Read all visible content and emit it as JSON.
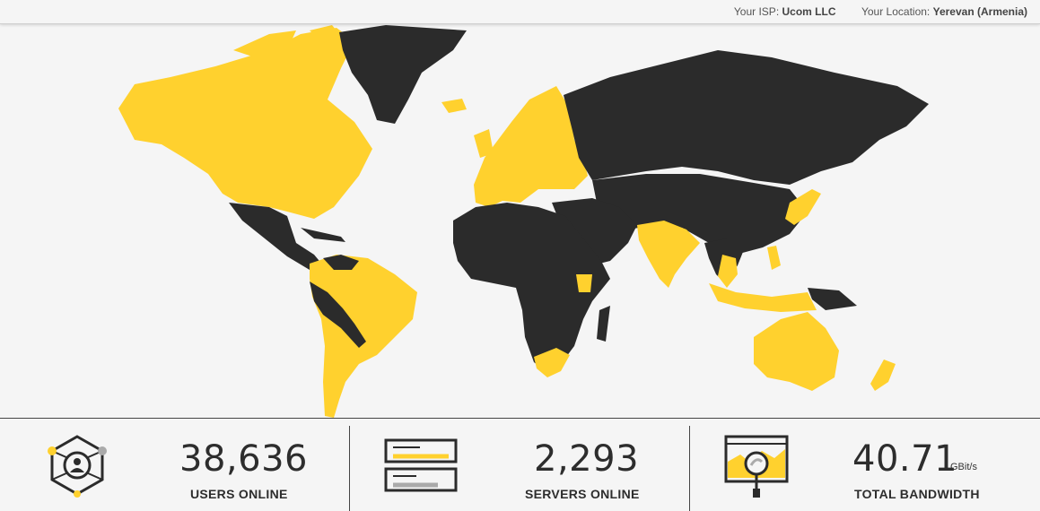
{
  "header": {
    "isp_label": "Your ISP:",
    "isp_value": "Ucom LLC",
    "location_label": "Your Location:",
    "location_value": "Yerevan (Armenia)"
  },
  "map": {
    "icon": "world-map",
    "colors": {
      "covered": "#ffd12e",
      "not_covered": "#2b2b2b",
      "background": "#f5f5f5"
    }
  },
  "stats": [
    {
      "value": "38,636",
      "caption": "USERS ONLINE",
      "unit": "",
      "icon": "users-network-icon"
    },
    {
      "value": "2,293",
      "caption": "SERVERS ONLINE",
      "unit": "",
      "icon": "server-rack-icon"
    },
    {
      "value": "40.71",
      "caption": "TOTAL BANDWIDTH",
      "unit": "GBit/s",
      "icon": "bandwidth-monitor-icon"
    }
  ],
  "colors": {
    "accent": "#ffd12e",
    "dark": "#2b2b2b",
    "grey": "#aaaaaa"
  }
}
